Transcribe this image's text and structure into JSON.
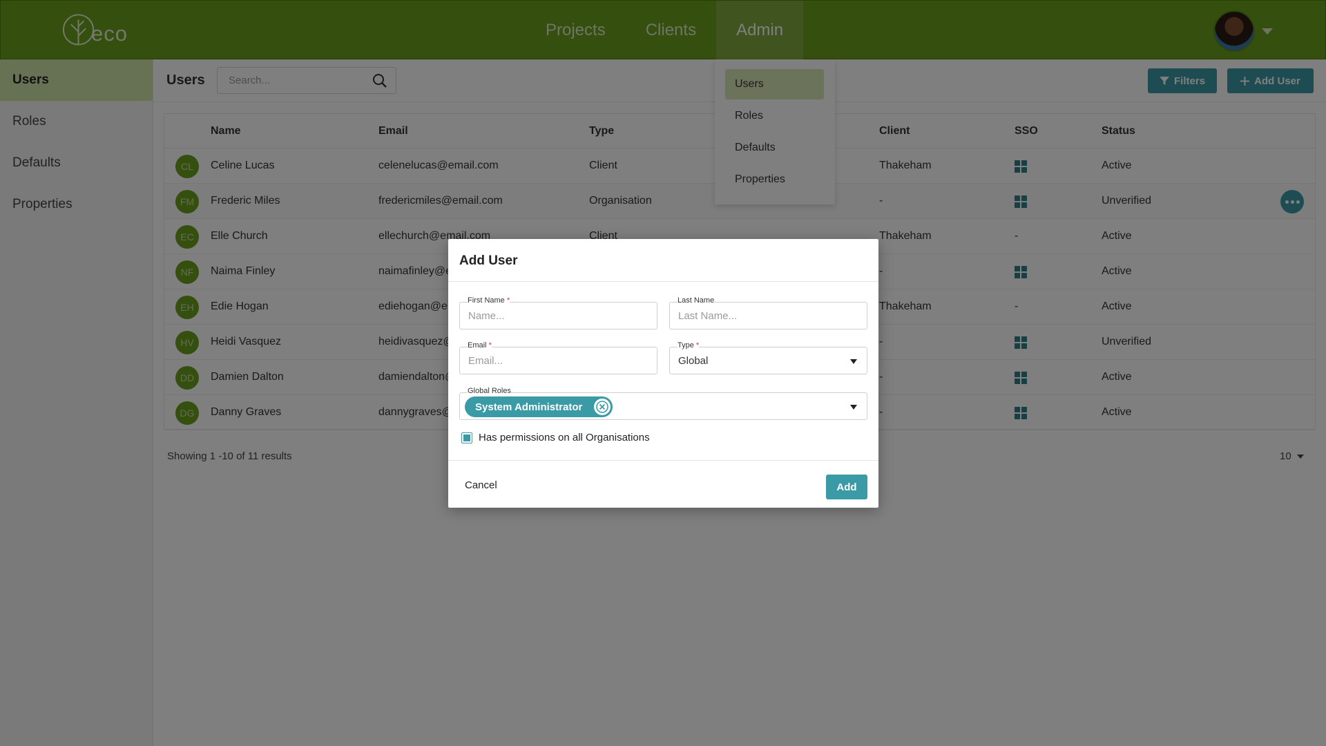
{
  "brand": {
    "logo_text": "eco",
    "accent": "#6a9e1f",
    "teal": "#3a9aa6"
  },
  "nav": {
    "items": [
      {
        "label": "Projects"
      },
      {
        "label": "Clients"
      },
      {
        "label": "Admin"
      }
    ]
  },
  "sidebar": {
    "items": [
      {
        "label": "Users"
      },
      {
        "label": "Roles"
      },
      {
        "label": "Defaults"
      },
      {
        "label": "Properties"
      }
    ]
  },
  "subheader": {
    "title": "Users",
    "search_placeholder": "Search...",
    "filters_label": "Filters",
    "add_user_label": "Add User"
  },
  "admin_menu": {
    "items": [
      {
        "label": "Users"
      },
      {
        "label": "Roles"
      },
      {
        "label": "Defaults"
      },
      {
        "label": "Properties"
      }
    ]
  },
  "table": {
    "columns": {
      "name": "Name",
      "email": "Email",
      "type": "Type",
      "client": "Client",
      "sso": "SSO",
      "status": "Status"
    },
    "rows": [
      {
        "initials": "CL",
        "name": "Celine Lucas",
        "email": "celenelucas@email.com",
        "type": "Client",
        "client": "Thakeham",
        "sso": true,
        "status": "Active"
      },
      {
        "initials": "FM",
        "name": "Frederic Miles",
        "email": "fredericmiles@email.com",
        "type": "Organisation",
        "client": "-",
        "sso": true,
        "status": "Unverified"
      },
      {
        "initials": "EC",
        "name": "Elle Church",
        "email": "ellechurch@email.com",
        "type": "Client",
        "client": "Thakeham",
        "sso": false,
        "status": "Active"
      },
      {
        "initials": "NF",
        "name": "Naima Finley",
        "email": "naimafinley@e",
        "type": "",
        "client": "-",
        "sso": true,
        "status": "Active"
      },
      {
        "initials": "EH",
        "name": "Edie Hogan",
        "email": "ediehogan@em",
        "type": "",
        "client": "Thakeham",
        "sso": false,
        "status": "Active"
      },
      {
        "initials": "HV",
        "name": "Heidi Vasquez",
        "email": "heidivasquez@",
        "type": "",
        "client": "-",
        "sso": true,
        "status": "Unverified"
      },
      {
        "initials": "DD",
        "name": "Damien Dalton",
        "email": "damiendalton@",
        "type": "",
        "client": "-",
        "sso": true,
        "status": "Active"
      },
      {
        "initials": "DG",
        "name": "Danny Graves",
        "email": "dannygraves@e",
        "type": "",
        "client": "-",
        "sso": true,
        "status": "Active"
      }
    ],
    "dash": "-"
  },
  "footer": {
    "showing": "Showing 1 -10 of 11 results",
    "page_size": "10"
  },
  "modal": {
    "title": "Add User",
    "first_name": {
      "label": "First Name",
      "required": "*",
      "placeholder": "Name..."
    },
    "last_name": {
      "label": "Last Name",
      "placeholder": "Last Name..."
    },
    "email": {
      "label": "Email",
      "required": "*",
      "placeholder": "Email..."
    },
    "type": {
      "label": "Type",
      "required": "*",
      "value": "Global"
    },
    "global_roles": {
      "label": "Global Roles",
      "chip": "System Administrator"
    },
    "checkbox_label": "Has permissions on all Organisations",
    "checkbox_checked": true,
    "cancel_label": "Cancel",
    "add_label": "Add"
  }
}
